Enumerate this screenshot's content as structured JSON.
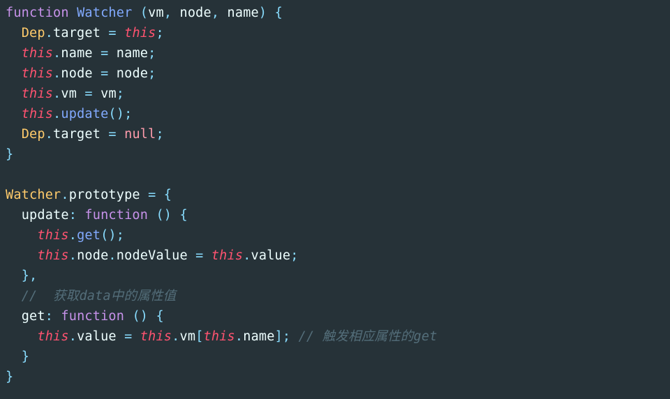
{
  "code": {
    "lines": [
      {
        "indent": 0,
        "tokens": [
          {
            "c": "kw",
            "t": "function"
          },
          {
            "c": "prop",
            "t": " "
          },
          {
            "c": "fn",
            "t": "Watcher"
          },
          {
            "c": "prop",
            "t": " "
          },
          {
            "c": "punc",
            "t": "("
          },
          {
            "c": "param",
            "t": "vm"
          },
          {
            "c": "punc",
            "t": ","
          },
          {
            "c": "prop",
            "t": " "
          },
          {
            "c": "param",
            "t": "node"
          },
          {
            "c": "punc",
            "t": ","
          },
          {
            "c": "prop",
            "t": " "
          },
          {
            "c": "param",
            "t": "name"
          },
          {
            "c": "punc",
            "t": ")"
          },
          {
            "c": "prop",
            "t": " "
          },
          {
            "c": "punc",
            "t": "{"
          }
        ]
      },
      {
        "indent": 1,
        "tokens": [
          {
            "c": "id",
            "t": "Dep"
          },
          {
            "c": "punc",
            "t": "."
          },
          {
            "c": "prop",
            "t": "target"
          },
          {
            "c": "prop",
            "t": " "
          },
          {
            "c": "op",
            "t": "="
          },
          {
            "c": "prop",
            "t": " "
          },
          {
            "c": "this",
            "t": "this"
          },
          {
            "c": "punc",
            "t": ";"
          }
        ]
      },
      {
        "indent": 1,
        "tokens": [
          {
            "c": "this",
            "t": "this"
          },
          {
            "c": "punc",
            "t": "."
          },
          {
            "c": "prop",
            "t": "name"
          },
          {
            "c": "prop",
            "t": " "
          },
          {
            "c": "op",
            "t": "="
          },
          {
            "c": "prop",
            "t": " "
          },
          {
            "c": "prop",
            "t": "name"
          },
          {
            "c": "punc",
            "t": ";"
          }
        ]
      },
      {
        "indent": 1,
        "tokens": [
          {
            "c": "this",
            "t": "this"
          },
          {
            "c": "punc",
            "t": "."
          },
          {
            "c": "prop",
            "t": "node"
          },
          {
            "c": "prop",
            "t": " "
          },
          {
            "c": "op",
            "t": "="
          },
          {
            "c": "prop",
            "t": " "
          },
          {
            "c": "prop",
            "t": "node"
          },
          {
            "c": "punc",
            "t": ";"
          }
        ]
      },
      {
        "indent": 1,
        "tokens": [
          {
            "c": "this",
            "t": "this"
          },
          {
            "c": "punc",
            "t": "."
          },
          {
            "c": "prop",
            "t": "vm"
          },
          {
            "c": "prop",
            "t": " "
          },
          {
            "c": "op",
            "t": "="
          },
          {
            "c": "prop",
            "t": " "
          },
          {
            "c": "prop",
            "t": "vm"
          },
          {
            "c": "punc",
            "t": ";"
          }
        ]
      },
      {
        "indent": 1,
        "tokens": [
          {
            "c": "this",
            "t": "this"
          },
          {
            "c": "punc",
            "t": "."
          },
          {
            "c": "fn",
            "t": "update"
          },
          {
            "c": "punc",
            "t": "();"
          }
        ]
      },
      {
        "indent": 1,
        "tokens": [
          {
            "c": "id",
            "t": "Dep"
          },
          {
            "c": "punc",
            "t": "."
          },
          {
            "c": "prop",
            "t": "target"
          },
          {
            "c": "prop",
            "t": " "
          },
          {
            "c": "op",
            "t": "="
          },
          {
            "c": "prop",
            "t": " "
          },
          {
            "c": "nullk",
            "t": "null"
          },
          {
            "c": "punc",
            "t": ";"
          }
        ]
      },
      {
        "indent": 0,
        "tokens": [
          {
            "c": "punc",
            "t": "}"
          }
        ]
      },
      {
        "indent": 0,
        "tokens": []
      },
      {
        "indent": 0,
        "tokens": [
          {
            "c": "id",
            "t": "Watcher"
          },
          {
            "c": "punc",
            "t": "."
          },
          {
            "c": "prop",
            "t": "prototype"
          },
          {
            "c": "prop",
            "t": " "
          },
          {
            "c": "op",
            "t": "="
          },
          {
            "c": "prop",
            "t": " "
          },
          {
            "c": "punc",
            "t": "{"
          }
        ]
      },
      {
        "indent": 1,
        "tokens": [
          {
            "c": "prop",
            "t": "update"
          },
          {
            "c": "punc",
            "t": ":"
          },
          {
            "c": "prop",
            "t": " "
          },
          {
            "c": "kw",
            "t": "function"
          },
          {
            "c": "prop",
            "t": " "
          },
          {
            "c": "punc",
            "t": "()"
          },
          {
            "c": "prop",
            "t": " "
          },
          {
            "c": "punc",
            "t": "{"
          }
        ]
      },
      {
        "indent": 2,
        "tokens": [
          {
            "c": "this",
            "t": "this"
          },
          {
            "c": "punc",
            "t": "."
          },
          {
            "c": "fn",
            "t": "get"
          },
          {
            "c": "punc",
            "t": "();"
          }
        ]
      },
      {
        "indent": 2,
        "tokens": [
          {
            "c": "this",
            "t": "this"
          },
          {
            "c": "punc",
            "t": "."
          },
          {
            "c": "prop",
            "t": "node"
          },
          {
            "c": "punc",
            "t": "."
          },
          {
            "c": "prop",
            "t": "nodeValue"
          },
          {
            "c": "prop",
            "t": " "
          },
          {
            "c": "op",
            "t": "="
          },
          {
            "c": "prop",
            "t": " "
          },
          {
            "c": "this",
            "t": "this"
          },
          {
            "c": "punc",
            "t": "."
          },
          {
            "c": "prop",
            "t": "value"
          },
          {
            "c": "punc",
            "t": ";"
          }
        ]
      },
      {
        "indent": 1,
        "tokens": [
          {
            "c": "punc",
            "t": "},"
          }
        ]
      },
      {
        "indent": 1,
        "tokens": [
          {
            "c": "cmt",
            "t": "//  获取data中的属性值"
          }
        ]
      },
      {
        "indent": 1,
        "tokens": [
          {
            "c": "prop",
            "t": "get"
          },
          {
            "c": "punc",
            "t": ":"
          },
          {
            "c": "prop",
            "t": " "
          },
          {
            "c": "kw",
            "t": "function"
          },
          {
            "c": "prop",
            "t": " "
          },
          {
            "c": "punc",
            "t": "()"
          },
          {
            "c": "prop",
            "t": " "
          },
          {
            "c": "punc",
            "t": "{"
          }
        ]
      },
      {
        "indent": 2,
        "tokens": [
          {
            "c": "this",
            "t": "this"
          },
          {
            "c": "punc",
            "t": "."
          },
          {
            "c": "prop",
            "t": "value"
          },
          {
            "c": "prop",
            "t": " "
          },
          {
            "c": "op",
            "t": "="
          },
          {
            "c": "prop",
            "t": " "
          },
          {
            "c": "this",
            "t": "this"
          },
          {
            "c": "punc",
            "t": "."
          },
          {
            "c": "prop",
            "t": "vm"
          },
          {
            "c": "punc",
            "t": "["
          },
          {
            "c": "this",
            "t": "this"
          },
          {
            "c": "punc",
            "t": "."
          },
          {
            "c": "prop",
            "t": "name"
          },
          {
            "c": "punc",
            "t": "];"
          },
          {
            "c": "prop",
            "t": " "
          },
          {
            "c": "cmt",
            "t": "// 触发相应属性的get"
          }
        ]
      },
      {
        "indent": 1,
        "tokens": [
          {
            "c": "punc",
            "t": "}"
          }
        ]
      },
      {
        "indent": 0,
        "tokens": [
          {
            "c": "punc",
            "t": "}"
          }
        ]
      }
    ]
  }
}
